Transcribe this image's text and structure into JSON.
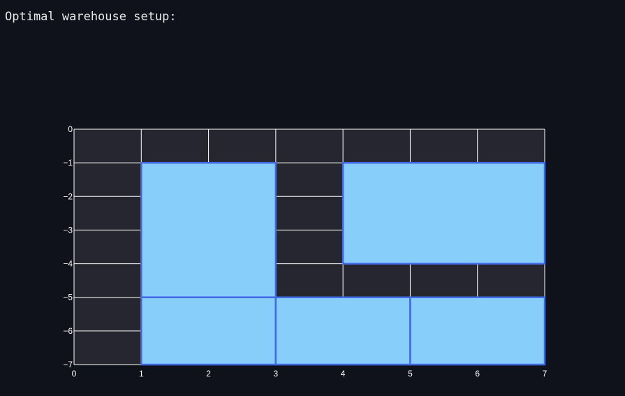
{
  "heading": "Optimal warehouse setup:",
  "colors": {
    "page_background": "#0f121a",
    "plot_background": "#262630",
    "grid": "#ffffff",
    "rect_fill": "#87cefa",
    "rect_stroke": "#4169e1",
    "text": "#ffffff"
  },
  "chart_data": {
    "type": "shapes",
    "title": "",
    "xlabel": "",
    "ylabel": "",
    "xlim": [
      0,
      7
    ],
    "ylim": [
      -7,
      0
    ],
    "xticks": [
      0,
      1,
      2,
      3,
      4,
      5,
      6,
      7
    ],
    "yticks": [
      0,
      -1,
      -2,
      -3,
      -4,
      -5,
      -6,
      -7
    ],
    "xtick_labels": [
      "0",
      "1",
      "2",
      "3",
      "4",
      "5",
      "6",
      "7"
    ],
    "ytick_labels": [
      "0",
      "−1",
      "−2",
      "−3",
      "−4",
      "−5",
      "−6",
      "−7"
    ],
    "grid": true,
    "rectangles": [
      {
        "x0": 1,
        "x1": 3,
        "y0": -5,
        "y1": -1
      },
      {
        "x0": 4,
        "x1": 7,
        "y0": -4,
        "y1": -1
      },
      {
        "x0": 1,
        "x1": 3,
        "y0": -7,
        "y1": -5
      },
      {
        "x0": 3,
        "x1": 5,
        "y0": -7,
        "y1": -5
      },
      {
        "x0": 5,
        "x1": 7,
        "y0": -7,
        "y1": -5
      }
    ]
  }
}
